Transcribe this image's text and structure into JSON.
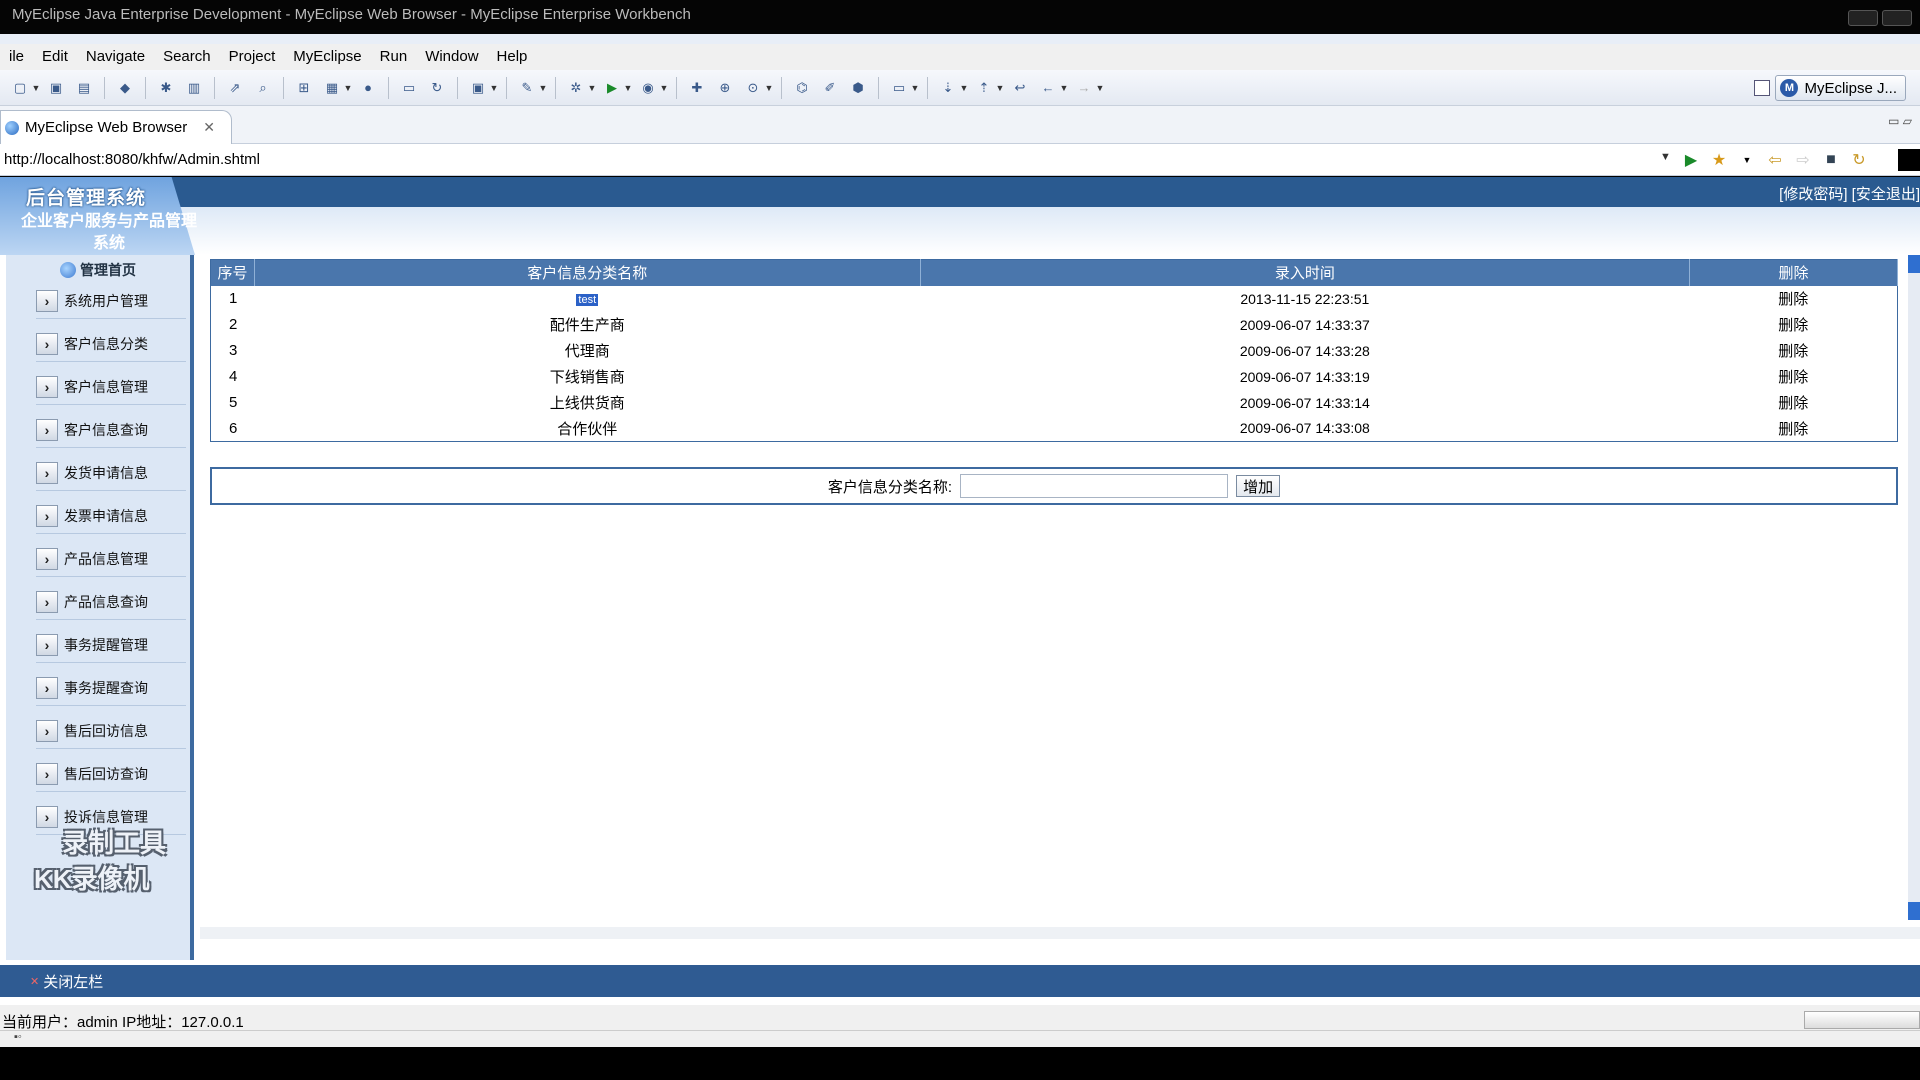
{
  "window": {
    "title": "MyEclipse Java Enterprise Development - MyEclipse Web Browser - MyEclipse Enterprise Workbench"
  },
  "menubar": {
    "items": [
      "ile",
      "Edit",
      "Navigate",
      "Search",
      "Project",
      "MyEclipse",
      "Run",
      "Window",
      "Help"
    ]
  },
  "toolbar": {
    "perspective_label": "MyEclipse J..."
  },
  "editor_tab": {
    "label": "MyEclipse Web Browser"
  },
  "browser": {
    "url": "http://localhost:8080/khfw/Admin.shtml"
  },
  "page": {
    "brand_title": "后台管理系统",
    "brand_subtitle": "企业客户服务与产品管理系统",
    "top_links": "[修改密码] [安全退出]",
    "home_label": "管理首页",
    "nav": [
      "系统用户管理",
      "客户信息分类",
      "客户信息管理",
      "客户信息查询",
      "发货申请信息",
      "发票申请信息",
      "产品信息管理",
      "产品信息查询",
      "事务提醒管理",
      "事务提醒查询",
      "售后回访信息",
      "售后回访查询",
      "投诉信息管理"
    ],
    "watermark_line1": "录制工具",
    "watermark_line2": "KK录像机",
    "table": {
      "headers": [
        "序号",
        "客户信息分类名称",
        "录入时间",
        "删除"
      ],
      "rows": [
        {
          "num": "1",
          "name": "test",
          "time": "2013-11-15 22:23:51",
          "action": "删除"
        },
        {
          "num": "2",
          "name": "配件生产商",
          "time": "2009-06-07 14:33:37",
          "action": "删除"
        },
        {
          "num": "3",
          "name": "代理商",
          "time": "2009-06-07 14:33:28",
          "action": "删除"
        },
        {
          "num": "4",
          "name": "下线销售商",
          "time": "2009-06-07 14:33:19",
          "action": "删除"
        },
        {
          "num": "5",
          "name": "上线供货商",
          "time": "2009-06-07 14:33:14",
          "action": "删除"
        },
        {
          "num": "6",
          "name": "合作伙伴",
          "time": "2009-06-07 14:33:08",
          "action": "删除"
        }
      ]
    },
    "form": {
      "label": "客户信息分类名称:",
      "input_value": "",
      "button": "增加"
    },
    "close_left": "关闭左栏",
    "status": "当前用户：admin  IP地址：127.0.0.1"
  },
  "colors": {
    "header_blue": "#2e5c92",
    "table_header": "#4a76ac",
    "sidebar_bg": "#dce7f5",
    "selection": "#2b61c7"
  }
}
